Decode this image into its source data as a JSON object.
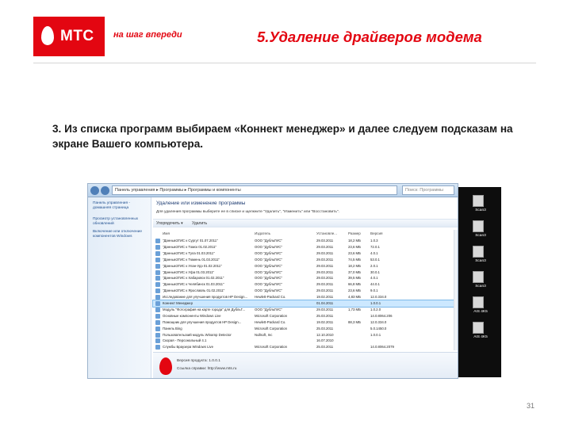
{
  "header": {
    "logo_text": "МТС",
    "slogan": "на шаг впереди",
    "slide_title": "5.Удаление драйверов модема",
    "brand_color": "#e30611"
  },
  "instruction": "3. Из списка программ выбираем «Коннект менеджер» и далее следуем подсказам на экране Вашего компьютера.",
  "window": {
    "address": "Панель управления ▸ Программы ▸ Программы и компоненты",
    "search_placeholder": "Поиск: Программы",
    "sidebar": [
      "Панель управления - домашняя страница",
      "Просмотр установленных обновлений",
      "Включение или отключение компонентов Windows"
    ],
    "heading": "Удаление или изменение программы",
    "subheading": "Для удаления программы выберите ее в списке и щелкните \"Удалить\", \"Изменить\" или \"Восстановить\".",
    "toolbar": [
      "Упорядочить ▾",
      "Удалить"
    ],
    "columns": [
      "Имя",
      "Издатель",
      "Установле...",
      "Размер",
      "Версия"
    ],
    "rows": [
      {
        "name": "\"ДанныеЗГИС к Сургут 01.07.2011\"",
        "publisher": "ООО \"ДубльГИС\"",
        "installed": "29.03.2011",
        "size": "18,2 МБ",
        "version": "1.0.3"
      },
      {
        "name": "\"ДанныеЗГИС к Томск 01.02.2011\"",
        "publisher": "ООО \"ДубльГИС\"",
        "installed": "29.03.2011",
        "size": "23,6 МБ",
        "version": "72.0.1"
      },
      {
        "name": "\"ДанныеЗГИС к Тула 01.03.2011\"",
        "publisher": "ООО \"ДубльГИС\"",
        "installed": "29.03.2011",
        "size": "23,6 МБ",
        "version": "4.0.1"
      },
      {
        "name": "\"ДанныеЗГИС к Тюмень 01.03.2011\"",
        "publisher": "ООО \"ДубльГИС\"",
        "installed": "29.03.2011",
        "size": "74,5 МБ",
        "version": "53.0.1"
      },
      {
        "name": "\"ДанныеЗГИС к Улан-Удэ 01.02.2011\"",
        "publisher": "ООО \"ДубльГИС\"",
        "installed": "29.03.2011",
        "size": "18,2 МБ",
        "version": "2.0.1"
      },
      {
        "name": "\"ДанныеЗГИС к Уфа 01.03.2011\"",
        "publisher": "ООО \"ДубльГИС\"",
        "installed": "29.03.2011",
        "size": "37,0 МБ",
        "version": "30.0.1"
      },
      {
        "name": "\"ДанныеЗГИС к Хабаровск 01.02.2011\"",
        "publisher": "ООО \"ДубльГИС\"",
        "installed": "29.03.2011",
        "size": "39,5 МБ",
        "version": "4.0.1"
      },
      {
        "name": "\"ДанныеЗГИС к Челябинск 01.03.2011\"",
        "publisher": "ООО \"ДубльГИС\"",
        "installed": "29.03.2011",
        "size": "66,8 МБ",
        "version": "44.0.1"
      },
      {
        "name": "\"ДанныеЗГИС к Ярославль 01.02.2011\"",
        "publisher": "ООО \"ДубльГИС\"",
        "installed": "29.03.2011",
        "size": "23,6 МБ",
        "version": "9.0.1"
      },
      {
        "name": "Исследование для улучшения продуктов HP Design...",
        "publisher": "Hewlett-Packard Co.",
        "installed": "19.02.2011",
        "size": "4,83 МБ",
        "version": "12.0.334.0"
      },
      {
        "name": "Коннект Менеджер",
        "publisher": "",
        "installed": "01.04.2011",
        "size": "",
        "version": "1.0.0.1",
        "selected": true
      },
      {
        "name": "Модуль \"Фотография на карте города\" для ДубльГ...",
        "publisher": "ООО \"ДубльГИС\"",
        "installed": "29.03.2011",
        "size": "1,73 МБ",
        "version": "1.0.2.0"
      },
      {
        "name": "Основные компоненты Windows Live",
        "publisher": "Microsoft Corporation",
        "installed": "25.03.2011",
        "size": "",
        "version": "14.0.8064.206"
      },
      {
        "name": "Помощник для улучшения продуктов HP Design...",
        "publisher": "Hewlett-Packard Co.",
        "installed": "19.02.2011",
        "size": "88,3 МБ",
        "version": "12.0.334.0"
      },
      {
        "name": "Панель Bing",
        "publisher": "Microsoft Corporation",
        "installed": "25.03.2011",
        "size": "",
        "version": "5.0.1450.0"
      },
      {
        "name": "Пользовательский модуль Winamp Detector",
        "publisher": "Nullsoft, Inc",
        "installed": "12.10.2010",
        "size": "",
        "version": "1.0.0.1"
      },
      {
        "name": "Скорая - Персональный 4.1",
        "publisher": "",
        "installed": "16.07.2010",
        "size": "",
        "version": ""
      },
      {
        "name": "Службы Браузера Windows Live",
        "publisher": "Microsoft Corporation",
        "installed": "25.03.2011",
        "size": "",
        "version": "14.0.8064.2079"
      }
    ],
    "status": {
      "version": "Версия продукта: 1.0.0.1",
      "help": "Ссылка справки: http://www.mts.ru"
    }
  },
  "desktop": [
    "Scan3",
    "Scan3",
    "Scan3",
    "Scan3",
    "AIS 4K5",
    "AIS 4K5"
  ],
  "page_number": "31"
}
